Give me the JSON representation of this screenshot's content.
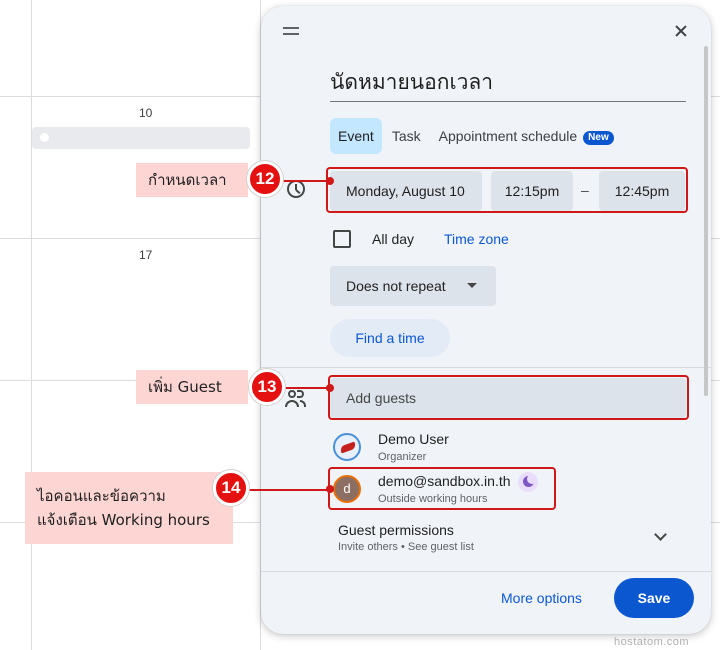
{
  "calendar": {
    "day_numbers": [
      "10",
      "17"
    ]
  },
  "dialog": {
    "title": "นัดหมายนอกเวลา",
    "tabs": [
      {
        "label": "Event",
        "active": true
      },
      {
        "label": "Task",
        "active": false
      },
      {
        "label": "Appointment schedule",
        "active": false,
        "badge": "New"
      }
    ],
    "datetime": {
      "date": "Monday, August 10",
      "start": "12:15pm",
      "separator": "–",
      "end": "12:45pm"
    },
    "all_day_label": "All day",
    "all_day_checked": false,
    "time_zone_link": "Time zone",
    "repeat": "Does not repeat",
    "find_time": "Find a time",
    "guests_placeholder": "Add guests",
    "guests": [
      {
        "name": "Demo User",
        "sub": "Organizer",
        "icon": "organizer-avatar-icon"
      },
      {
        "name": "demo@sandbox.in.th",
        "sub": "Outside working hours",
        "initial": "d",
        "status_icon": "moon-icon"
      }
    ],
    "permissions": {
      "title": "Guest permissions",
      "sub": "Invite others • See guest list"
    },
    "more_options": "More options",
    "save": "Save"
  },
  "annotations": [
    {
      "number": "12",
      "label": "กำหนดเวลา"
    },
    {
      "number": "13",
      "label": "เพิ่ม Guest"
    },
    {
      "number": "14",
      "label_line1": "ไอคอนและข้อความ",
      "label_line2": "แจ้งเตือน Working hours"
    }
  ],
  "watermark": "hostatom.com",
  "colors": {
    "accent": "#0b57d0",
    "annotation_red": "#d01818",
    "callout_bg": "#fdd5d3",
    "tab_active_bg": "#c2e7ff"
  }
}
